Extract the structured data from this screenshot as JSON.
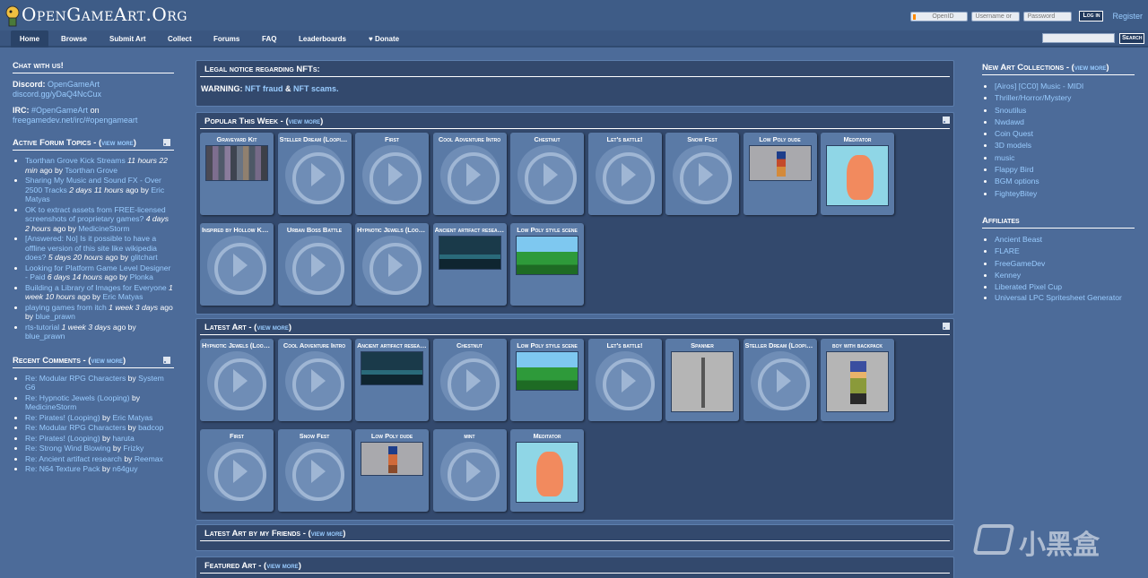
{
  "header": {
    "site_title": "OpenGameArt.Org",
    "login": {
      "openid": "OpenID",
      "username_placeholder": "Username or",
      "password_placeholder": "Password",
      "login_button": "Log in",
      "register": "Register"
    }
  },
  "nav": {
    "items": [
      "Home",
      "Browse",
      "Submit Art",
      "Collect",
      "Forums",
      "FAQ",
      "Leaderboards",
      "♥ Donate"
    ],
    "search_button": "Search"
  },
  "left": {
    "chat": {
      "title": "Chat with us!",
      "discord_label": "Discord:",
      "discord_name": "OpenGameArt",
      "discord_url": "discord.gg/yDaQ4NcCux",
      "irc_label": "IRC:",
      "irc_channel": "#OpenGameArt",
      "irc_on": "on",
      "irc_url": "freegamedev.net/irc/#opengameart"
    },
    "forum": {
      "title": "Active Forum Topics - (",
      "view_more": "view more",
      "title_close": ")",
      "items": [
        {
          "topic": "Tsorthan Grove Kick Streams",
          "time": "11 hours 22 min",
          "ago": "ago by",
          "user": "Tsorthan Grove"
        },
        {
          "topic": "Sharing My Music and Sound FX - Over 2500 Tracks",
          "time": "2 days 11 hours",
          "ago": "ago by",
          "user": "Eric Matyas"
        },
        {
          "topic": "OK to extract assets from FREE-licensed screenshots of proprietary games?",
          "time": "4 days 2 hours",
          "ago": "ago by",
          "user": "MedicineStorm"
        },
        {
          "topic": "[Answered: No] Is it possible to have a offline version of this site like wikipedia does?",
          "time": "5 days 20 hours",
          "ago": "ago by",
          "user": "glitchart"
        },
        {
          "topic": "Looking for Platform Game Level Designer - Paid",
          "time": "6 days 14 hours",
          "ago": "ago by",
          "user": "Plonka"
        },
        {
          "topic": "Building a Library of Images for Everyone",
          "time": "1 week 10 hours",
          "ago": "ago by",
          "user": "Eric Matyas"
        },
        {
          "topic": "playing games from itch",
          "time": "1 week 3 days",
          "ago": "ago by",
          "user": "blue_prawn"
        },
        {
          "topic": "rts-tutorial",
          "time": "1 week 3 days",
          "ago": "ago by",
          "user": "blue_prawn"
        }
      ]
    },
    "comments": {
      "title": "Recent Comments - (",
      "view_more": "view more",
      "title_close": ")",
      "items": [
        {
          "topic": "Re: Modular RPG Characters",
          "by": "by",
          "user": "System G6"
        },
        {
          "topic": "Re: Hypnotic Jewels (Looping)",
          "by": "by",
          "user": "MedicineStorm"
        },
        {
          "topic": "Re: Pirates! (Looping)",
          "by": "by",
          "user": "Eric Matyas"
        },
        {
          "topic": "Re: Modular RPG Characters",
          "by": "by",
          "user": "badcop"
        },
        {
          "topic": "Re: Pirates! (Looping)",
          "by": "by",
          "user": "haruta"
        },
        {
          "topic": "Re: Strong Wind Blowing",
          "by": "by",
          "user": "Frizky"
        },
        {
          "topic": "Re: Ancient artifact research",
          "by": "by",
          "user": "Reemax"
        },
        {
          "topic": "Re: N64 Texture Pack",
          "by": "by",
          "user": "n64guy"
        }
      ]
    }
  },
  "center": {
    "nft": {
      "title": "Legal notice regarding NFTs:",
      "warning": "WARNING:",
      "link1": "NFT fraud",
      "amp": "&",
      "link2": "NFT scams."
    },
    "popular": {
      "title": "Popular This Week - (",
      "view_more": "view more",
      "title_close": ")",
      "tiles": [
        {
          "title": "Graveyard Kit",
          "kind": "graveyard"
        },
        {
          "title": "Steller Dream (Looping)",
          "kind": "audio"
        },
        {
          "title": "First",
          "kind": "audio"
        },
        {
          "title": "Cool Adventure Intro",
          "kind": "audio"
        },
        {
          "title": "Chestnut",
          "kind": "audio"
        },
        {
          "title": "Let's battle!",
          "kind": "audio"
        },
        {
          "title": "Snow Fest",
          "kind": "audio"
        },
        {
          "title": "Low Poly dude",
          "kind": "char"
        },
        {
          "title": "Meditator",
          "kind": "med"
        },
        {
          "title": "Inspired by Hollow Knight",
          "kind": "audio"
        },
        {
          "title": "Urban Boss Battle",
          "kind": "audio"
        },
        {
          "title": "Hypnotic Jewels (Looping)",
          "kind": "audio"
        },
        {
          "title": "Ancient artifact research",
          "kind": "artifact"
        },
        {
          "title": "Low Poly style scene",
          "kind": "lowpoly"
        }
      ]
    },
    "latest": {
      "title": "Latest Art - (",
      "view_more": "view more",
      "title_close": ")",
      "tiles": [
        {
          "title": "Hypnotic Jewels (Looping)",
          "kind": "audio"
        },
        {
          "title": "Cool Adventure Intro",
          "kind": "audio"
        },
        {
          "title": "Ancient artifact research",
          "kind": "artifact"
        },
        {
          "title": "Chestnut",
          "kind": "audio"
        },
        {
          "title": "Low Poly style scene",
          "kind": "lowpoly"
        },
        {
          "title": "Let's battle!",
          "kind": "audio"
        },
        {
          "title": "Spanner",
          "kind": "spanner"
        },
        {
          "title": "Steller Dream (Looping)",
          "kind": "audio"
        },
        {
          "title": "boy with backpack",
          "kind": "boy"
        },
        {
          "title": "First",
          "kind": "audio"
        },
        {
          "title": "Snow Fest",
          "kind": "audio"
        },
        {
          "title": "Low Poly dude",
          "kind": "lowpoly2"
        },
        {
          "title": "mint",
          "kind": "audio"
        },
        {
          "title": "Meditator",
          "kind": "med"
        }
      ]
    },
    "friends": {
      "title": "Latest Art by my Friends - (",
      "view_more": "view more",
      "title_close": ")"
    },
    "featured": {
      "title": "Featured Art - (",
      "view_more": "view more",
      "title_close": ")"
    }
  },
  "right": {
    "collections": {
      "title": "New Art Collections - (",
      "view_more": "view more",
      "title_close": ")",
      "items": [
        "[Airos] [CC0] Music - MIDI",
        "Thriller/Horror/Mystery",
        "Snoutilus",
        "Nwdawd",
        "Coin Quest",
        "3D models",
        "music",
        "Flappy Bird",
        "BGM options",
        "FighteyBitey"
      ]
    },
    "affiliates": {
      "title": "Affiliates",
      "items": [
        "Ancient Beast",
        "FLARE",
        "FreeGameDev",
        "Kenney",
        "Liberated Pixel Cup",
        "Universal LPC Spritesheet Generator"
      ]
    }
  },
  "watermark": "小黑盒"
}
